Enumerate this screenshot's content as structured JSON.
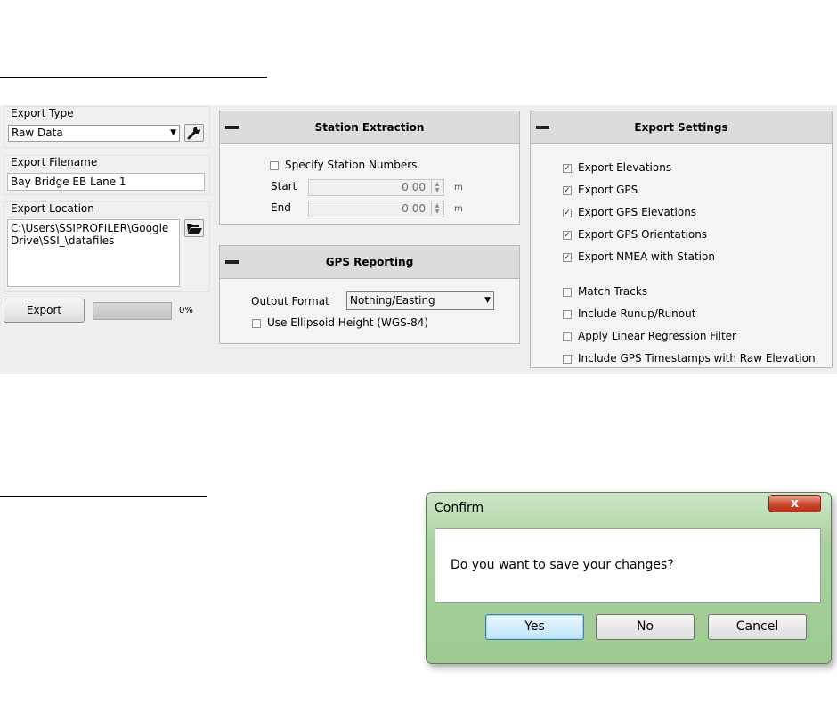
{
  "export_panel": {
    "export_type_label": "Export Type",
    "export_type_value": "Raw Data",
    "export_filename_label": "Export Filename",
    "export_filename_value": "Bay Bridge EB Lane 1",
    "export_location_label": "Export Location",
    "export_location_value": "C:\\Users\\SSIPROFILER\\Google Drive\\SSI_\\datafiles",
    "export_button": "Export",
    "progress_text": "0%",
    "progress_value": 0,
    "wrench_icon": "wrench-icon",
    "folder_icon": "folder-open-icon"
  },
  "station_extraction": {
    "title": "Station Extraction",
    "specify_label": "Specify Station Numbers",
    "specify_checked": false,
    "start_label": "Start",
    "start_value": "0.00",
    "start_unit": "m",
    "end_label": "End",
    "end_value": "0.00",
    "end_unit": "m"
  },
  "gps_reporting": {
    "title": "GPS Reporting",
    "output_format_label": "Output Format",
    "output_format_value": "Nothing/Easting",
    "ellipsoid_label": "Use Ellipsoid Height (WGS-84)",
    "ellipsoid_checked": false
  },
  "export_settings": {
    "title": "Export Settings",
    "options": [
      {
        "label": "Export Elevations",
        "checked": true
      },
      {
        "label": "Export GPS",
        "checked": true
      },
      {
        "label": "Export GPS Elevations",
        "checked": true
      },
      {
        "label": "Export GPS Orientations",
        "checked": true
      },
      {
        "label": "Export NMEA with Station",
        "checked": true
      },
      {
        "label": "Match Tracks",
        "checked": false
      },
      {
        "label": "Include Runup/Runout",
        "checked": false
      },
      {
        "label": "Apply Linear Regression Filter",
        "checked": false
      },
      {
        "label": "Include GPS Timestamps with Raw Elevation",
        "checked": false
      }
    ]
  },
  "confirm_dialog": {
    "title": "Confirm",
    "close_glyph": "x",
    "message": "Do you want to save your changes?",
    "yes": "Yes",
    "no": "No",
    "cancel": "Cancel"
  },
  "colors": {
    "dialog_frame": "#a9d09e",
    "close_button": "#c9452b",
    "default_button": "#bee6fd"
  }
}
